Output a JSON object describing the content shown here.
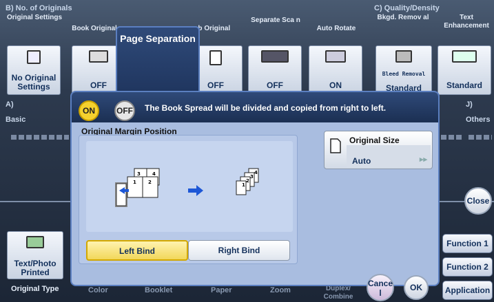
{
  "background": {
    "section_b": "B)  No. of Originals",
    "section_c": "C)  Quality/Density",
    "section_a": "A)",
    "section_a_sub": "Basic",
    "section_j": "J)",
    "section_j_sub": "Others",
    "col_original_settings": "Original Settings",
    "col_book_original": "Book Original",
    "col_tab_original": "ab Original",
    "col_separate_scan": "Separate Sca n",
    "col_auto_rotate": "Auto Rotate",
    "col_bkgd_removal": "Bkgd. Remov al",
    "col_text_enhancement": "Text Enhancement",
    "tile_no_original": "No Original Settings",
    "tile_book": "OFF",
    "tile_page_sep": "ON",
    "tile_tab": "OFF",
    "tile_separate": "OFF",
    "tile_rotate": "ON",
    "tile_bleed": "Bleed Removal",
    "tile_standard_sub": "Standard",
    "tile_text_enh": "Standard",
    "text_photo": "Text/Photo Printed",
    "original_type": "Original Type",
    "bottom_color": "Color",
    "bottom_booklet": "Booklet",
    "bottom_paper": "Paper",
    "bottom_zoom": "Zoom",
    "bottom_duplex": "Duplex/ Combine",
    "close_label": "Close",
    "function1": "Function 1",
    "function2": "Function 2",
    "application": "Application"
  },
  "dialog": {
    "title": "Page Separation",
    "toggle_on": "ON",
    "toggle_off": "OFF",
    "message": "The Book Spread will be divided and copied from right to left.",
    "margin_label": "Original Margin Position",
    "left_bind": "Left Bind",
    "right_bind": "Right Bind",
    "original_size_label": "Original Size",
    "original_size_value": "Auto",
    "cancel": "Cance l",
    "ok": "OK"
  },
  "colors": {
    "accent": "#f5d12e",
    "dialog_bg": "#a9bde0",
    "header_bg": "#1b2f52"
  }
}
